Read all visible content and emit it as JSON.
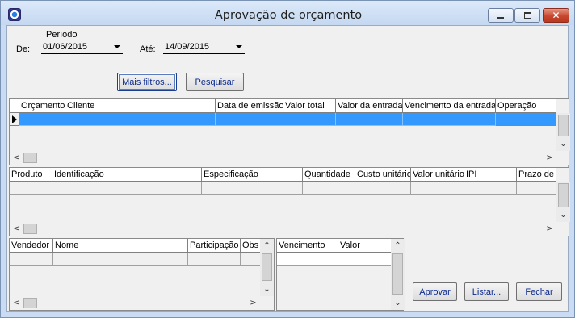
{
  "window": {
    "title": "Aprovação de orçamento"
  },
  "filters": {
    "period_label": "Período",
    "from_label": "De:",
    "from_value": "01/06/2015",
    "to_label": "Até:",
    "to_value": "14/09/2015",
    "more_filters_label": "Mais filtros...",
    "search_label": "Pesquisar"
  },
  "budgets_grid": {
    "columns": [
      "Orçamento",
      "Cliente",
      "Data de emissão",
      "Valor total",
      "Valor da entrada",
      "Vencimento da entrada",
      "Operação"
    ]
  },
  "products_grid": {
    "columns": [
      "Produto",
      "Identificação",
      "Especificação",
      "Quantidade",
      "Custo unitário",
      "Valor unitário",
      "IPI",
      "Prazo de"
    ]
  },
  "sellers_grid": {
    "columns": [
      "Vendedor",
      "Nome",
      "Participação",
      "Obs"
    ]
  },
  "installments_grid": {
    "columns": [
      "Vencimento",
      "Valor"
    ]
  },
  "actions": {
    "approve_label": "Aprovar",
    "list_label": "Listar...",
    "close_label": "Fechar"
  },
  "colors": {
    "selection": "#3399ff",
    "accent_text": "#0b2a8c",
    "titlebar": "#c9dcf3",
    "close_button": "#c8462e"
  },
  "icons": [
    "app-icon",
    "minimize-icon",
    "maximize-icon",
    "close-icon",
    "chevron-down-icon",
    "row-indicator-icon",
    "arrow-left-icon",
    "arrow-right-icon",
    "arrow-up-icon",
    "arrow-down-icon"
  ]
}
